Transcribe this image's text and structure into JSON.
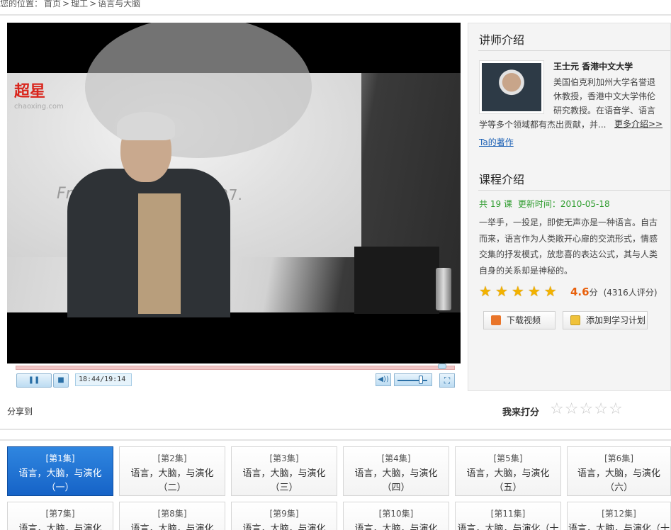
{
  "breadcrumb": {
    "prefix": "您的位置：",
    "items": [
      "首页",
      ">",
      "理工",
      ">",
      "语言与大脑"
    ]
  },
  "player": {
    "logo": "超星",
    "logo_sub": "chaoxing.com",
    "slide_text": "Fro",
    "slide_text2": "27.",
    "play_icon": "pause-icon",
    "stop_icon": "stop-icon",
    "time": "18:44/19:14",
    "progress": 0.974,
    "volume": 0.7
  },
  "teacher": {
    "heading": "讲师介绍",
    "name": "王士元 香港中文大学",
    "desc": "美国伯克利加州大学名誉退休教授，香港中文大学伟伦研究教授。在语音学、语言",
    "desc2": "学等多个领域都有杰出贡献，并...",
    "more": "更多介绍>>",
    "works": "Ta的著作"
  },
  "course": {
    "heading": "课程介绍",
    "count": "共 19 课",
    "updated": "更新时间：2010-05-18",
    "desc": "一举手，一投足，即使无声亦是一种语言。自古而来，语言作为人类敞开心扉的交流形式，情感交集的抒发模式，放悲喜的表达公式，其与人类自身的关系却是神秘的。",
    "rating": "4.6",
    "rating_unit": "分",
    "rating_count": "(4316人评分)",
    "stars": 5,
    "download": "下载视频",
    "add_plan": "添加到学习计划"
  },
  "share": "分享到",
  "rate": {
    "label": "我来打分",
    "max": 5
  },
  "episodes": [
    {
      "num": "[第1集]",
      "title": "语言，大脑，与演化",
      "sub": "（一）",
      "active": true
    },
    {
      "num": "[第2集]",
      "title": "语言，大脑，与演化",
      "sub": "（二）"
    },
    {
      "num": "[第3集]",
      "title": "语言，大脑，与演化",
      "sub": "（三）"
    },
    {
      "num": "[第4集]",
      "title": "语言，大脑，与演化",
      "sub": "（四）"
    },
    {
      "num": "[第5集]",
      "title": "语言，大脑，与演化",
      "sub": "（五）"
    },
    {
      "num": "[第6集]",
      "title": "语言，大脑，与演化",
      "sub": "（六）"
    },
    {
      "num": "[第7集]",
      "title": "语言，大脑，与演化",
      "sub": ""
    },
    {
      "num": "[第8集]",
      "title": "语言，大脑，与演化",
      "sub": ""
    },
    {
      "num": "[第9集]",
      "title": "语言，大脑，与演化",
      "sub": ""
    },
    {
      "num": "[第10集]",
      "title": "语言，大脑，与演化",
      "sub": ""
    },
    {
      "num": "[第11集]",
      "title": "语言，大脑，与演化（十",
      "sub": ""
    },
    {
      "num": "[第12集]",
      "title": "语言，大脑，与演化（十",
      "sub": ""
    }
  ]
}
